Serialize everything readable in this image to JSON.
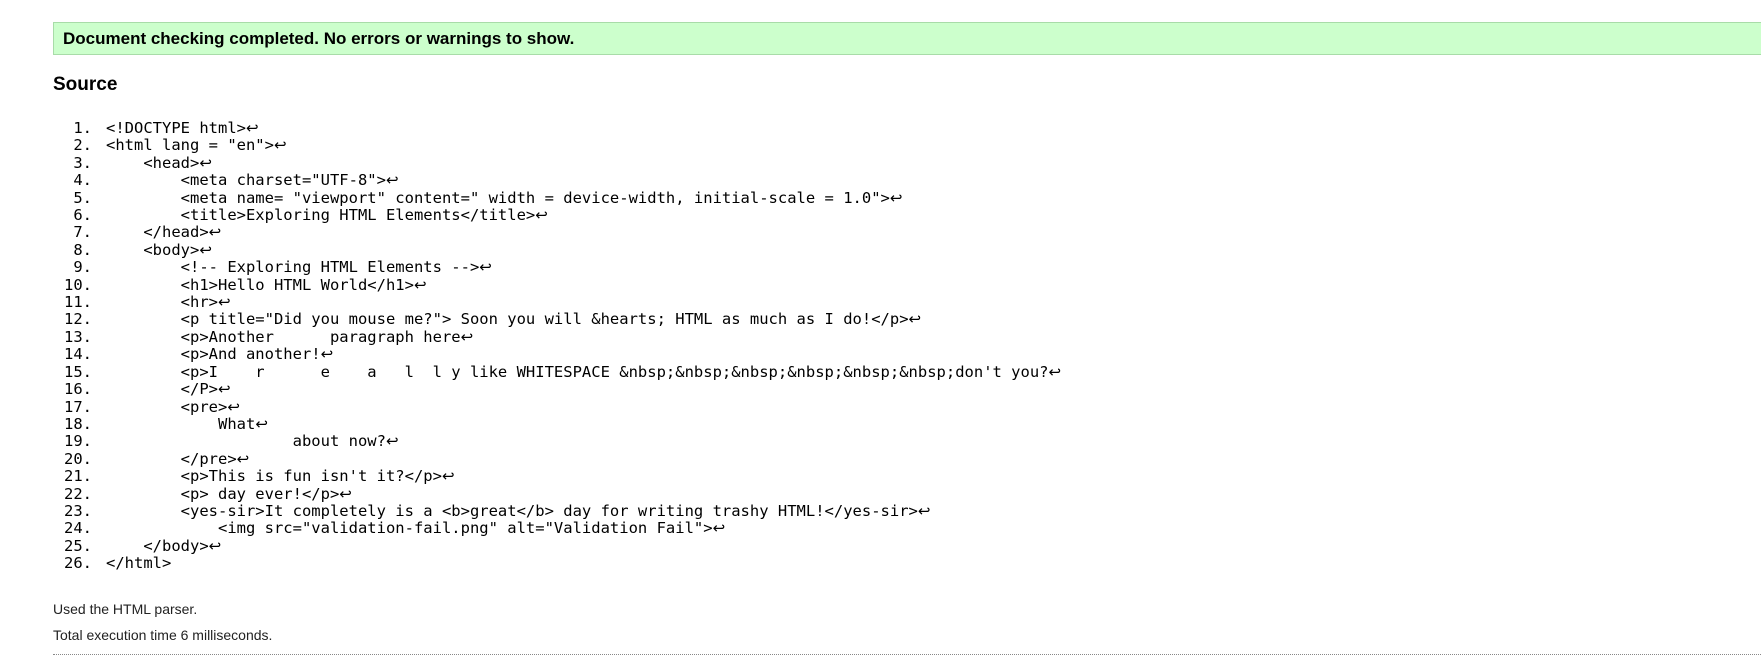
{
  "banner": {
    "message": "Document checking completed. No errors or warnings to show."
  },
  "source": {
    "heading": "Source",
    "line_end_glyph": "↩",
    "lines": [
      {
        "no": "1.",
        "code": "<!DOCTYPE html>",
        "lf": true
      },
      {
        "no": "2.",
        "code": "<html lang = \"en\">",
        "lf": true
      },
      {
        "no": "3.",
        "code": "    <head>",
        "lf": true
      },
      {
        "no": "4.",
        "code": "        <meta charset=\"UTF-8\">",
        "lf": true
      },
      {
        "no": "5.",
        "code": "        <meta name= \"viewport\" content=\" width = device-width, initial-scale = 1.0\">",
        "lf": true
      },
      {
        "no": "6.",
        "code": "        <title>Exploring HTML Elements</title>",
        "lf": true
      },
      {
        "no": "7.",
        "code": "    </head>",
        "lf": true
      },
      {
        "no": "8.",
        "code": "    <body>",
        "lf": true
      },
      {
        "no": "9.",
        "code": "        <!-- Exploring HTML Elements -->",
        "lf": true
      },
      {
        "no": "10.",
        "code": "        <h1>Hello HTML World</h1>",
        "lf": true
      },
      {
        "no": "11.",
        "code": "        <hr>",
        "lf": true
      },
      {
        "no": "12.",
        "code": "        <p title=\"Did you mouse me?\"> Soon you will &hearts; HTML as much as I do!</p>",
        "lf": true
      },
      {
        "no": "13.",
        "code": "        <p>Another      paragraph here",
        "lf": true
      },
      {
        "no": "14.",
        "code": "        <p>And another!",
        "lf": true
      },
      {
        "no": "15.",
        "code": "        <p>I    r      e    a   l  l y like WHITESPACE &nbsp;&nbsp;&nbsp;&nbsp;&nbsp;&nbsp;don't you?",
        "lf": true
      },
      {
        "no": "16.",
        "code": "        </P>",
        "lf": true
      },
      {
        "no": "17.",
        "code": "        <pre>",
        "lf": true
      },
      {
        "no": "18.",
        "code": "            What",
        "lf": true
      },
      {
        "no": "19.",
        "code": "                    about now?",
        "lf": true
      },
      {
        "no": "20.",
        "code": "        </pre>",
        "lf": true
      },
      {
        "no": "21.",
        "code": "        <p>This is fun isn't it?</p>",
        "lf": true
      },
      {
        "no": "22.",
        "code": "        <p> day ever!</p>",
        "lf": true
      },
      {
        "no": "23.",
        "code": "        <yes-sir>It completely is a <b>great</b> day for writing trashy HTML!</yes-sir>",
        "lf": true
      },
      {
        "no": "24.",
        "code": "            <img src=\"validation-fail.png\" alt=\"Validation Fail\">",
        "lf": true
      },
      {
        "no": "25.",
        "code": "    </body>",
        "lf": true
      },
      {
        "no": "26.",
        "code": "</html>",
        "lf": false
      }
    ]
  },
  "footer": {
    "parser_note": "Used the HTML parser.",
    "exec_note": "Total execution time 6 milliseconds."
  }
}
